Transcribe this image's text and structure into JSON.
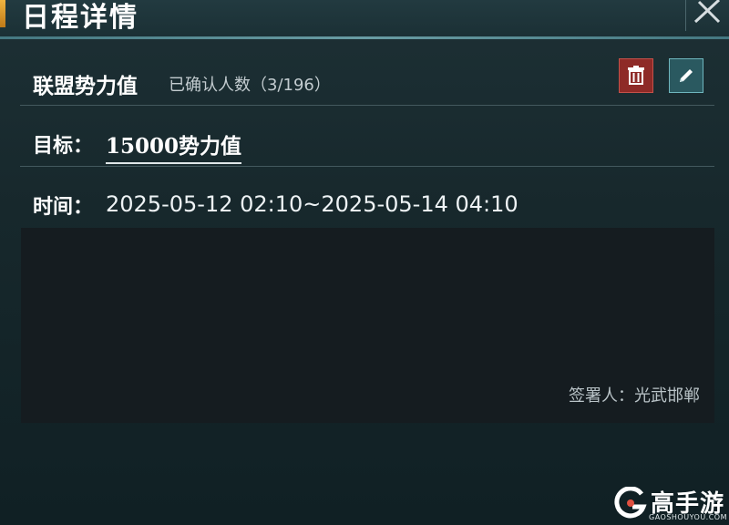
{
  "header": {
    "title": "日程详情",
    "close_icon": "close-x-icon"
  },
  "schedule": {
    "title": "联盟势力值",
    "confirmed": "已确认人数（3/196）",
    "delete_icon": "trash-icon",
    "edit_icon": "pencil-icon",
    "goal_label": "目标：",
    "goal_value": "15000势力值",
    "time_label": "时间：",
    "time_value": "2025-05-12 02:10~2025-05-14 04:10",
    "signer": "签署人：光武邯郸"
  },
  "watermark": {
    "name": "高手游",
    "url": "GAOSHOUYOU.COM"
  },
  "colors": {
    "delete_bg": "#8e2a27",
    "edit_bg": "#2a5960",
    "accent": "#f0b440"
  }
}
